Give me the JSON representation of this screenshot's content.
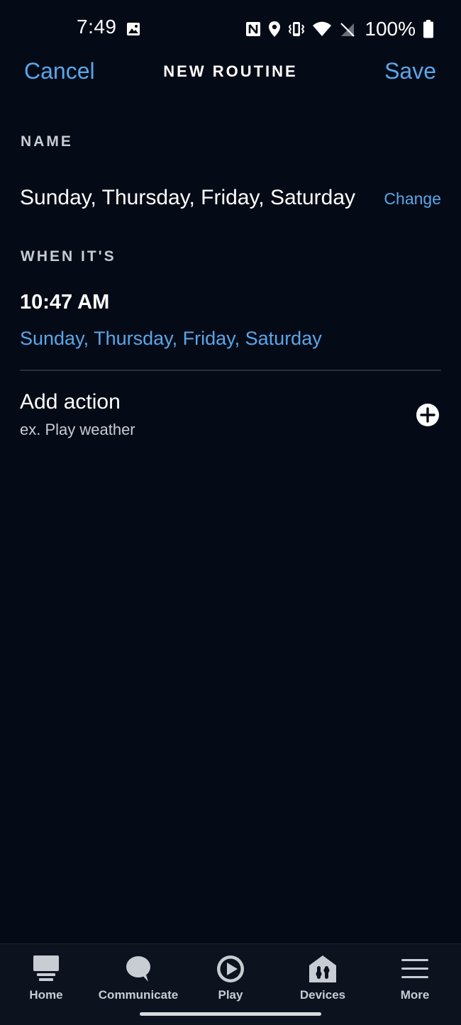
{
  "status_bar": {
    "time": "7:49",
    "battery": "100%",
    "icons": [
      "image-icon",
      "nfc-icon",
      "location-icon",
      "vibrate-icon",
      "wifi-icon",
      "no-signal-icon",
      "battery-icon"
    ]
  },
  "header": {
    "cancel_label": "Cancel",
    "title": "NEW ROUTINE",
    "save_label": "Save"
  },
  "name_section": {
    "label": "NAME",
    "value": "Sunday, Thursday, Friday, Saturday",
    "change_label": "Change"
  },
  "when_section": {
    "label": "WHEN IT'S",
    "time": "10:47 AM",
    "days": "Sunday, Thursday, Friday, Saturday"
  },
  "action": {
    "title": "Add action",
    "subtitle": "ex. Play weather"
  },
  "bottom_nav": {
    "items": [
      {
        "label": "Home",
        "icon": "home-icon"
      },
      {
        "label": "Communicate",
        "icon": "communicate-icon"
      },
      {
        "label": "Play",
        "icon": "play-icon"
      },
      {
        "label": "Devices",
        "icon": "devices-icon"
      },
      {
        "label": "More",
        "icon": "more-icon"
      }
    ]
  },
  "colors": {
    "background": "#050b16",
    "accent": "#5aa6ea",
    "text": "#ffffff",
    "muted": "#c8ccd3",
    "nav_background": "#0c131f"
  }
}
